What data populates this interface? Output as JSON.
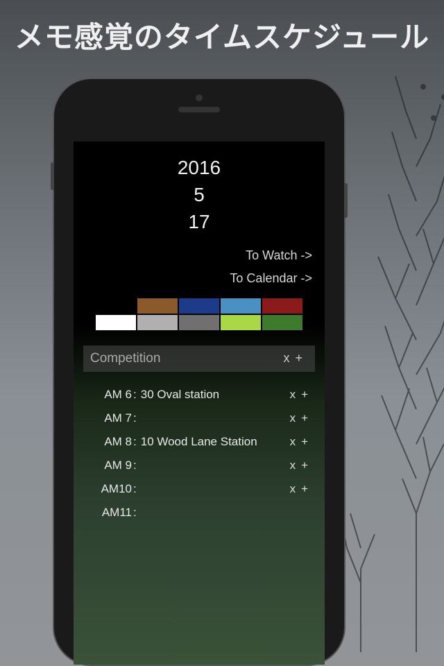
{
  "headline": "メモ感覚のタイムスケジュール",
  "date": {
    "year": "2016",
    "month": "5",
    "day": "17"
  },
  "nav": {
    "watch": "To Watch ->",
    "calendar": "To Calendar ->"
  },
  "palette": {
    "row1": [
      "#000000",
      "#8b5a2b",
      "#1e3a8a",
      "#4a90c2",
      "#8b1a1a"
    ],
    "row2": [
      "#ffffff",
      "#b0b0b0",
      "#707070",
      "#a8d846",
      "#3d7a2e"
    ]
  },
  "title_input": {
    "value": "Competition",
    "delete": "x",
    "add": "+"
  },
  "schedule": [
    {
      "time": "AM 6",
      "entry": "30 Oval station",
      "delete": "x",
      "add": "+"
    },
    {
      "time": "AM 7",
      "entry": "",
      "delete": "x",
      "add": "+"
    },
    {
      "time": "AM 8",
      "entry": "10 Wood Lane Station",
      "delete": "x",
      "add": "+"
    },
    {
      "time": "AM 9",
      "entry": "",
      "delete": "x",
      "add": "+"
    },
    {
      "time": "AM10",
      "entry": "",
      "delete": "x",
      "add": "+"
    },
    {
      "time": "AM11",
      "entry": "",
      "delete": "",
      "add": ""
    }
  ]
}
